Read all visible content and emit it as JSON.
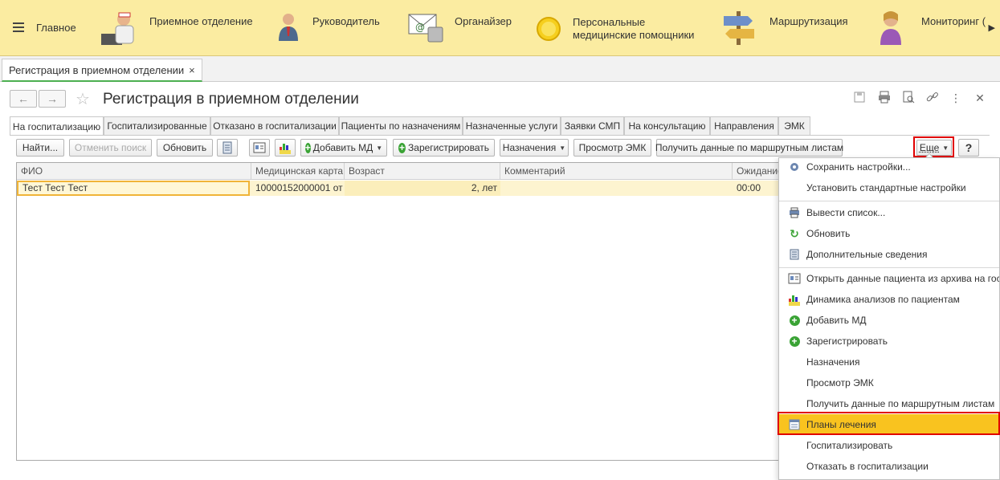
{
  "sections": {
    "menu_icon": "hamburger-icon",
    "items": [
      {
        "label": "Главное"
      },
      {
        "label": "Приемное отделение",
        "icon": "receptionist-icon"
      },
      {
        "label": "Руководитель",
        "icon": "manager-icon"
      },
      {
        "label": "Органайзер",
        "icon": "organizer-icon"
      },
      {
        "label_line1": "Персональные",
        "label_line2": "медицинские помощники",
        "icon": "assistant-icon"
      },
      {
        "label": "Маршрутизация",
        "icon": "signpost-icon"
      },
      {
        "label": "Мониторинг (",
        "icon": "monitoring-icon"
      }
    ]
  },
  "window_tab": {
    "label": "Регистрация в приемном отделении",
    "close": "×"
  },
  "form": {
    "title": "Регистрация в приемном отделении",
    "back": "←",
    "forward": "→"
  },
  "tabs": [
    "На госпитализацию",
    "Госпитализированные",
    "Отказано в госпитализации",
    "Пациенты по назначениям",
    "Назначенные услуги",
    "Заявки СМП",
    "На консультацию",
    "Направления",
    "ЭМК"
  ],
  "toolbar": {
    "find": "Найти...",
    "cancel_search": "Отменить поиск",
    "refresh": "Обновить",
    "add_md": "Добавить МД",
    "register": "Зарегистрировать",
    "appointments": "Назначения",
    "view_emk": "Просмотр ЭМК",
    "route_sheets": "Получить данные по маршрутным листам",
    "more": "Еще",
    "help": "?"
  },
  "table": {
    "columns": [
      "ФИО",
      "Медицинская карта",
      "Возраст",
      "Комментарий",
      "Ожидание"
    ],
    "rows": [
      {
        "fio": "Тест Тест Тест",
        "card": "10000152000001 от ...",
        "age": "2, лет",
        "comment": "",
        "wait": "00:00"
      }
    ]
  },
  "menu": {
    "items": [
      {
        "label": "Сохранить настройки...",
        "icon": "save-settings-icon"
      },
      {
        "label": "Установить стандартные настройки",
        "icon": ""
      },
      {
        "label": "Вывести список...",
        "icon": "print-list-icon"
      },
      {
        "label": "Обновить",
        "icon": "refresh-icon"
      },
      {
        "label": "Дополнительные сведения",
        "icon": "details-icon"
      },
      {
        "label": "Открыть данные пациента из архива на госпитализацию",
        "icon": "archive-icon"
      },
      {
        "label": "Динамика анализов по пациентам",
        "icon": "analysis-icon"
      },
      {
        "label": "Добавить МД",
        "icon": "add-icon"
      },
      {
        "label": "Зарегистрировать",
        "icon": "add-icon"
      },
      {
        "label": "Назначения",
        "icon": ""
      },
      {
        "label": "Просмотр ЭМК",
        "icon": ""
      },
      {
        "label": "Получить данные по маршрутным листам",
        "icon": ""
      },
      {
        "label": "Планы лечения",
        "icon": "treatment-plan-icon",
        "highlighted": true
      },
      {
        "label": "Госпитализировать",
        "icon": ""
      },
      {
        "label": "Отказать в госпитализации",
        "icon": ""
      }
    ]
  },
  "colors": {
    "section_bar": "#fbeca1",
    "row_highlight": "#fdf4d0",
    "menu_highlight": "#f9c31f",
    "annotation_red": "#e00000",
    "add_green": "#3aa335"
  }
}
